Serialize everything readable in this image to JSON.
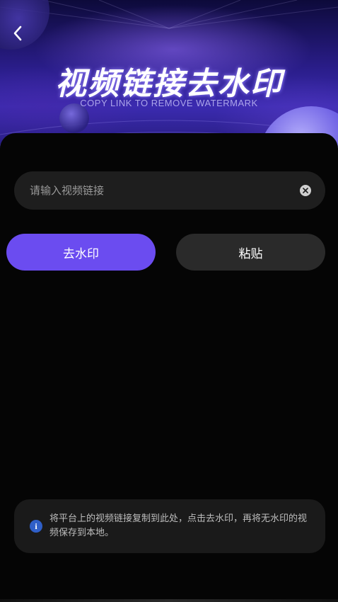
{
  "header": {
    "back_icon": "chevron-left-icon",
    "title": "视频链接去水印",
    "subtitle": "COPY LINK TO REMOVE WATERMARK"
  },
  "input": {
    "placeholder": "请输入视频链接",
    "value": "",
    "clear_icon": "clear-circle-icon"
  },
  "actions": {
    "remove_label": "去水印",
    "paste_label": "粘贴"
  },
  "tip": {
    "icon": "info-icon",
    "text": "将平台上的视频链接复制到此处，点击去水印，再将无水印的视频保存到本地。"
  },
  "colors": {
    "accent": "#6b4cf0",
    "background": "#000000",
    "input_bg": "#1e1e1e",
    "secondary_button": "#2a2a2a",
    "info": "#2f5fc8"
  }
}
